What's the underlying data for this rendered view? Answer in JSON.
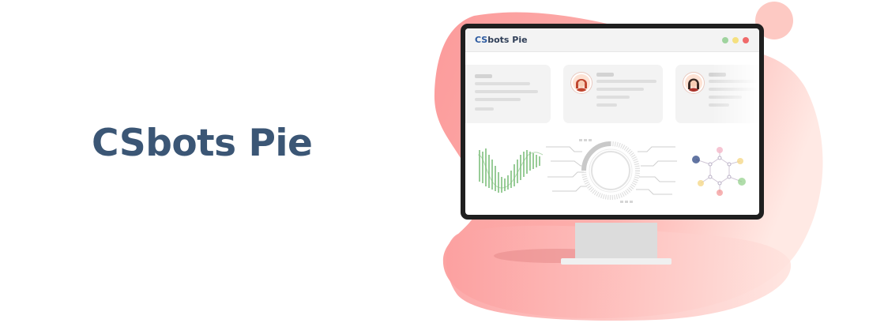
{
  "hero": {
    "title": "CSbots Pie"
  },
  "window": {
    "title_prefix": "CS",
    "title_rest": "bots Pie"
  },
  "colors": {
    "title": "#3b5675",
    "blob": "#fca3a3",
    "window_dot_green": "#9fd39e",
    "window_dot_yellow": "#f5e07f",
    "window_dot_red": "#f06a6a"
  },
  "icons": [
    "waveform-chart-icon",
    "radial-gauge-icon",
    "network-graph-icon",
    "user-avatar-icon"
  ]
}
